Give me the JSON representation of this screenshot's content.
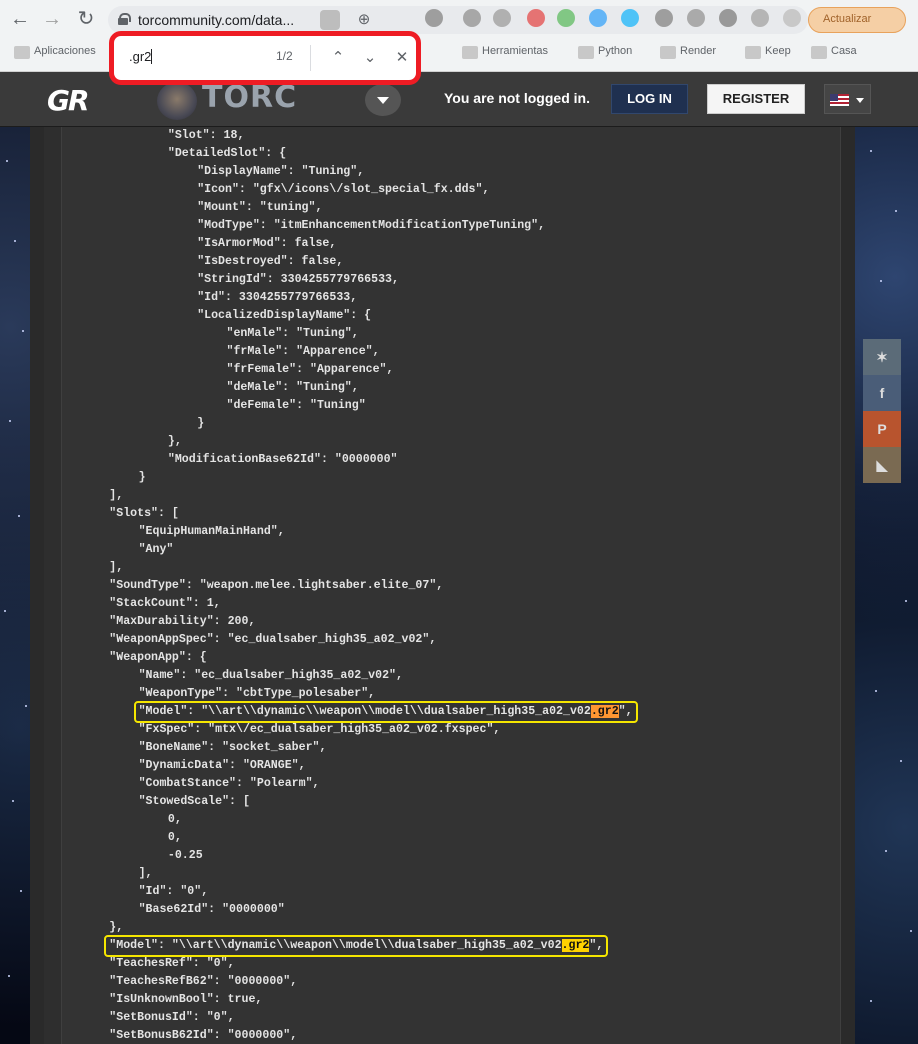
{
  "browser": {
    "url": "torcommunity.com/data...",
    "bookmarks": [
      {
        "label": "Aplicaciones"
      },
      {
        "label": "Herramientas"
      },
      {
        "label": "Python"
      },
      {
        "label": "Render"
      },
      {
        "label": "Keep"
      },
      {
        "label": "Casa"
      }
    ],
    "profile_label": "Actualizar",
    "find": {
      "query": ".gr2",
      "match_count": "1/2"
    }
  },
  "site": {
    "logo": "GR",
    "brand": "TORC",
    "login_status": "You are not logged in.",
    "login_label": "LOG IN",
    "register_label": "REGISTER"
  },
  "code_lines": [
    {
      "text": "\"Slot\": 18,",
      "indent": 3
    },
    {
      "text": "\"DetailedSlot\": {",
      "indent": 3
    },
    {
      "text": "\"DisplayName\": \"Tuning\",",
      "indent": 4
    },
    {
      "text": "\"Icon\": \"gfx\\/icons\\/slot_special_fx.dds\",",
      "indent": 4
    },
    {
      "text": "\"Mount\": \"tuning\",",
      "indent": 4
    },
    {
      "text": "\"ModType\": \"itmEnhancementModificationTypeTuning\",",
      "indent": 4
    },
    {
      "text": "\"IsArmorMod\": false,",
      "indent": 4
    },
    {
      "text": "\"IsDestroyed\": false,",
      "indent": 4
    },
    {
      "text": "\"StringId\": 3304255779766533,",
      "indent": 4
    },
    {
      "text": "\"Id\": 3304255779766533,",
      "indent": 4
    },
    {
      "text": "\"LocalizedDisplayName\": {",
      "indent": 4
    },
    {
      "text": "\"enMale\": \"Tuning\",",
      "indent": 5
    },
    {
      "text": "\"frMale\": \"Apparence\",",
      "indent": 5
    },
    {
      "text": "\"frFemale\": \"Apparence\",",
      "indent": 5
    },
    {
      "text": "\"deMale\": \"Tuning\",",
      "indent": 5
    },
    {
      "text": "\"deFemale\": \"Tuning\"",
      "indent": 5
    },
    {
      "text": "}",
      "indent": 4
    },
    {
      "text": "},",
      "indent": 3
    },
    {
      "text": "\"ModificationBase62Id\": \"0000000\"",
      "indent": 3
    },
    {
      "text": "}",
      "indent": 2
    },
    {
      "text": "],",
      "indent": 1
    },
    {
      "text": "\"Slots\": [",
      "indent": 1
    },
    {
      "text": "\"EquipHumanMainHand\",",
      "indent": 2
    },
    {
      "text": "\"Any\"",
      "indent": 2
    },
    {
      "text": "],",
      "indent": 1
    },
    {
      "text": "\"SoundType\": \"weapon.melee.lightsaber.elite_07\",",
      "indent": 1
    },
    {
      "text": "\"StackCount\": 1,",
      "indent": 1
    },
    {
      "text": "\"MaxDurability\": 200,",
      "indent": 1
    },
    {
      "text": "\"WeaponAppSpec\": \"ec_dualsaber_high35_a02_v02\",",
      "indent": 1
    },
    {
      "text": "\"WeaponApp\": {",
      "indent": 1
    },
    {
      "text": "\"Name\": \"ec_dualsaber_high35_a02_v02\",",
      "indent": 2
    },
    {
      "text": "\"WeaponType\": \"cbtType_polesaber\",",
      "indent": 2
    },
    {
      "text": "\"Model\": \"\\\\art\\\\dynamic\\\\weapon\\\\model\\\\dualsaber_high35_a02_v02",
      "indent": 2,
      "match": ".gr2",
      "after": "\",",
      "match_style": "current"
    },
    {
      "text": "\"FxSpec\": \"mtx\\/ec_dualsaber_high35_a02_v02.fxspec\",",
      "indent": 2
    },
    {
      "text": "\"BoneName\": \"socket_saber\",",
      "indent": 2
    },
    {
      "text": "\"DynamicData\": \"ORANGE\",",
      "indent": 2
    },
    {
      "text": "\"CombatStance\": \"Polearm\",",
      "indent": 2
    },
    {
      "text": "\"StowedScale\": [",
      "indent": 2
    },
    {
      "text": "0,",
      "indent": 3
    },
    {
      "text": "0,",
      "indent": 3
    },
    {
      "text": "-0.25",
      "indent": 3
    },
    {
      "text": "],",
      "indent": 2
    },
    {
      "text": "\"Id\": \"0\",",
      "indent": 2
    },
    {
      "text": "\"Base62Id\": \"0000000\"",
      "indent": 2
    },
    {
      "text": "},",
      "indent": 1
    },
    {
      "text": "\"Model\": \"\\\\art\\\\dynamic\\\\weapon\\\\model\\\\dualsaber_high35_a02_v02",
      "indent": 1,
      "match": ".gr2",
      "after": "\",",
      "match_style": "other"
    },
    {
      "text": "\"TeachesRef\": \"0\",",
      "indent": 1
    },
    {
      "text": "\"TeachesRefB62\": \"0000000\",",
      "indent": 1
    },
    {
      "text": "\"IsUnknownBool\": true,",
      "indent": 1
    },
    {
      "text": "\"SetBonusId\": \"0\",",
      "indent": 1
    },
    {
      "text": "\"SetBonusB62Id\": \"0000000\",",
      "indent": 1
    }
  ],
  "social": [
    {
      "icon": "twitter-icon",
      "color": "#5b6b78"
    },
    {
      "icon": "facebook-icon",
      "color": "#4a5d78"
    },
    {
      "icon": "patreon-icon",
      "color": "#b8542e"
    },
    {
      "icon": "rss-icon",
      "color": "#7a6a52"
    }
  ],
  "colors": {
    "findbar_border": "#ee1c24",
    "highlight_box": "#f5e600",
    "current_match": "#ff9632",
    "other_match": "#ffd200"
  }
}
